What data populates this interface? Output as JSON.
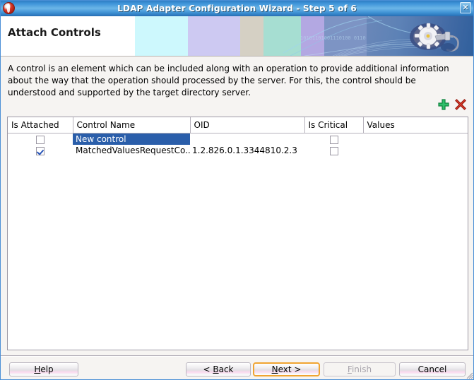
{
  "window": {
    "title": "LDAP Adapter Configuration Wizard - Step 5 of 6",
    "app_icon": "oracle-logo-icon",
    "close_label": "✕"
  },
  "banner": {
    "heading": "Attach Controls",
    "decoration_icon": "gear-plug-icon",
    "colors": {
      "band_white": "#ffffff",
      "band_cyan": "#cdf8fd",
      "band_lavender": "#cdc9f2",
      "band_beige": "#d5d0c4",
      "band_mint": "#a6ded2",
      "band_violet": "#b3a8e2",
      "band_blue": "#7d94c4",
      "band_darkblue": "#2f5f9c"
    }
  },
  "description": "A control is an element which can be included along with an operation to provide additional information about the way that the operation should processed by the server. For this, the control should be understood and supported by the target directory server.",
  "toolbar": {
    "add_icon": "plus-icon",
    "add_tooltip": "Add",
    "delete_icon": "delete-x-icon",
    "delete_tooltip": "Delete",
    "add_color": "#1faa4e",
    "delete_color": "#cc2020"
  },
  "table": {
    "columns": [
      {
        "key": "is_attached",
        "label": "Is Attached"
      },
      {
        "key": "control_name",
        "label": "Control Name"
      },
      {
        "key": "oid",
        "label": "OID"
      },
      {
        "key": "is_critical",
        "label": "Is Critical"
      },
      {
        "key": "values",
        "label": "Values"
      }
    ],
    "rows": [
      {
        "is_attached": false,
        "control_name": "New control",
        "control_name_selected": true,
        "oid": "",
        "is_critical": false,
        "values": ""
      },
      {
        "is_attached": true,
        "control_name": "MatchedValuesRequestCo...",
        "control_name_selected": false,
        "oid": "1.2.826.0.1.3344810.2.3",
        "is_critical": false,
        "values": ""
      }
    ],
    "selection_color": "#2a5eaa"
  },
  "footer": {
    "help": {
      "before": "",
      "mnemonic": "H",
      "after": "elp"
    },
    "back": {
      "before": "< ",
      "mnemonic": "B",
      "after": "ack"
    },
    "next": {
      "before": "",
      "mnemonic": "N",
      "after": "ext >"
    },
    "finish": {
      "before": "",
      "mnemonic": "F",
      "after": "inish",
      "disabled": true
    },
    "cancel": {
      "before": "",
      "mnemonic": "",
      "after": "Cancel"
    },
    "default_button_accent": "#f0a431"
  }
}
